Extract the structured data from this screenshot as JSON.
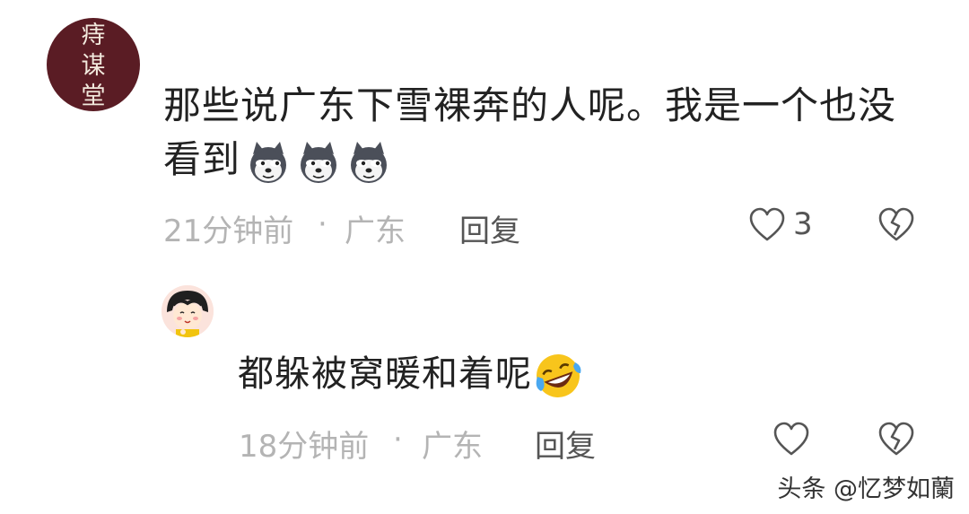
{
  "comments": [
    {
      "avatar_lettering": [
        "痔",
        "谋",
        "堂"
      ],
      "text": "那些说广东下雪裸奔的人呢。我是一个也没看到",
      "emoji": [
        "doge-emoji",
        "doge-emoji",
        "doge-emoji"
      ],
      "time": "21分钟前",
      "separator": "·",
      "location": "广东",
      "reply_label": "回复",
      "like_count": "3"
    },
    {
      "text": "都躲被窝暖和着呢",
      "emoji": [
        "laughing-tears-emoji"
      ],
      "time": "18分钟前",
      "separator": "·",
      "location": "广东",
      "reply_label": "回复",
      "like_count": ""
    }
  ],
  "watermark": "头条 @忆梦如蘭"
}
